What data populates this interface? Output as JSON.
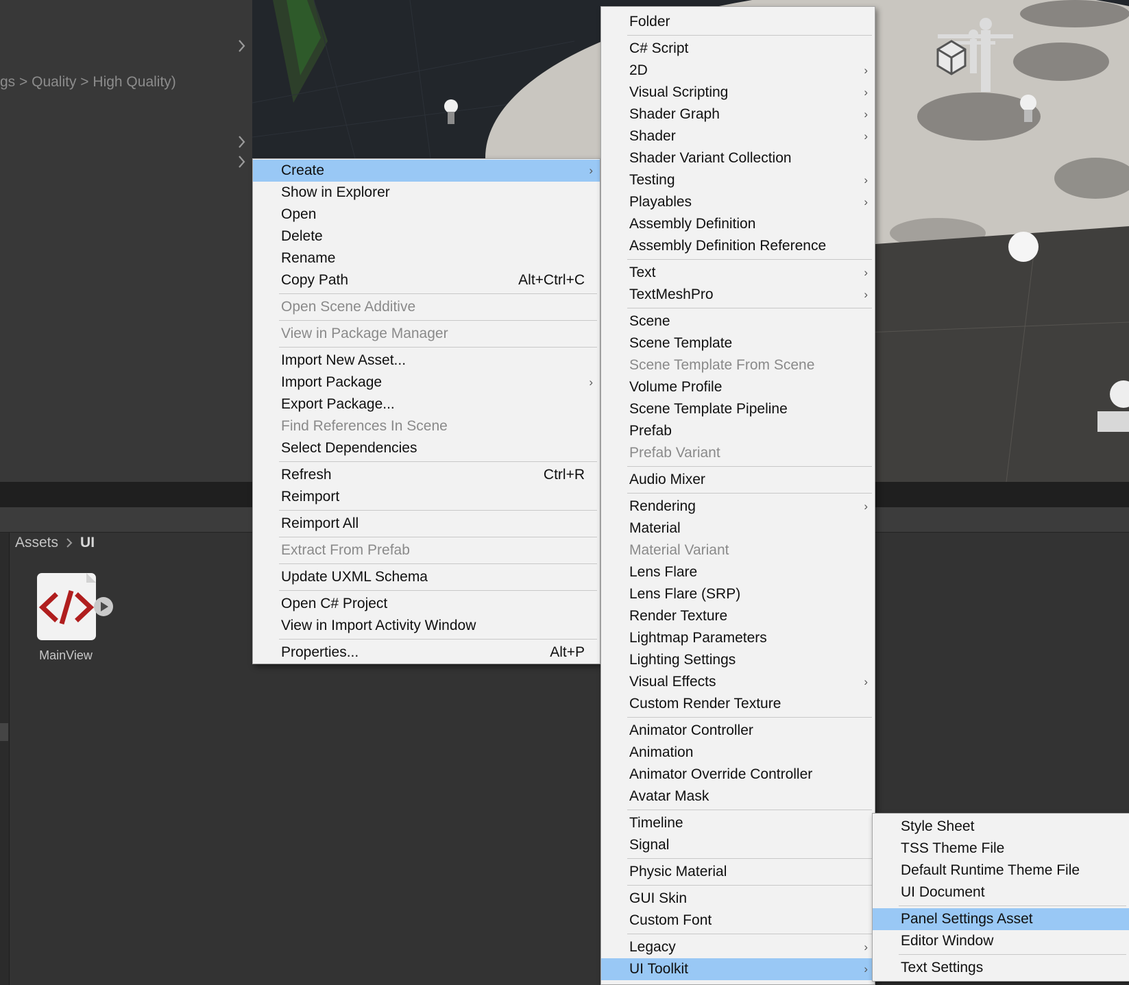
{
  "editor": {
    "breadcrumb_top": "gs > Quality > High Quality)",
    "project_breadcrumb": {
      "root": "Assets",
      "current": "UI"
    },
    "asset": {
      "name": "MainView",
      "icon": "uxml-document-icon"
    }
  },
  "menus": {
    "main": [
      {
        "label": "Create",
        "submenu": true,
        "selected": true
      },
      {
        "label": "Show in Explorer"
      },
      {
        "label": "Open"
      },
      {
        "label": "Delete"
      },
      {
        "label": "Rename"
      },
      {
        "label": "Copy Path",
        "shortcut": "Alt+Ctrl+C"
      },
      {
        "separator": true
      },
      {
        "label": "Open Scene Additive",
        "disabled": true
      },
      {
        "separator": true
      },
      {
        "label": "View in Package Manager",
        "disabled": true
      },
      {
        "separator": true
      },
      {
        "label": "Import New Asset..."
      },
      {
        "label": "Import Package",
        "submenu": true
      },
      {
        "label": "Export Package..."
      },
      {
        "label": "Find References In Scene",
        "disabled": true
      },
      {
        "label": "Select Dependencies"
      },
      {
        "separator": true
      },
      {
        "label": "Refresh",
        "shortcut": "Ctrl+R"
      },
      {
        "label": "Reimport"
      },
      {
        "separator": true
      },
      {
        "label": "Reimport All"
      },
      {
        "separator": true
      },
      {
        "label": "Extract From Prefab",
        "disabled": true
      },
      {
        "separator": true
      },
      {
        "label": "Update UXML Schema"
      },
      {
        "separator": true
      },
      {
        "label": "Open C# Project"
      },
      {
        "label": "View in Import Activity Window"
      },
      {
        "separator": true
      },
      {
        "label": "Properties...",
        "shortcut": "Alt+P"
      }
    ],
    "create": [
      {
        "label": "Folder"
      },
      {
        "separator": true
      },
      {
        "label": "C# Script"
      },
      {
        "label": "2D",
        "submenu": true
      },
      {
        "label": "Visual Scripting",
        "submenu": true
      },
      {
        "label": "Shader Graph",
        "submenu": true
      },
      {
        "label": "Shader",
        "submenu": true
      },
      {
        "label": "Shader Variant Collection"
      },
      {
        "label": "Testing",
        "submenu": true
      },
      {
        "label": "Playables",
        "submenu": true
      },
      {
        "label": "Assembly Definition"
      },
      {
        "label": "Assembly Definition Reference"
      },
      {
        "separator": true
      },
      {
        "label": "Text",
        "submenu": true
      },
      {
        "label": "TextMeshPro",
        "submenu": true
      },
      {
        "separator": true
      },
      {
        "label": "Scene"
      },
      {
        "label": "Scene Template"
      },
      {
        "label": "Scene Template From Scene",
        "disabled": true
      },
      {
        "label": "Volume Profile"
      },
      {
        "label": "Scene Template Pipeline"
      },
      {
        "label": "Prefab"
      },
      {
        "label": "Prefab Variant",
        "disabled": true
      },
      {
        "separator": true
      },
      {
        "label": "Audio Mixer"
      },
      {
        "separator": true
      },
      {
        "label": "Rendering",
        "submenu": true
      },
      {
        "label": "Material"
      },
      {
        "label": "Material Variant",
        "disabled": true
      },
      {
        "label": "Lens Flare"
      },
      {
        "label": "Lens Flare (SRP)"
      },
      {
        "label": "Render Texture"
      },
      {
        "label": "Lightmap Parameters"
      },
      {
        "label": "Lighting Settings"
      },
      {
        "label": "Visual Effects",
        "submenu": true
      },
      {
        "label": "Custom Render Texture"
      },
      {
        "separator": true
      },
      {
        "label": "Animator Controller"
      },
      {
        "label": "Animation"
      },
      {
        "label": "Animator Override Controller"
      },
      {
        "label": "Avatar Mask"
      },
      {
        "separator": true
      },
      {
        "label": "Timeline"
      },
      {
        "label": "Signal"
      },
      {
        "separator": true
      },
      {
        "label": "Physic Material"
      },
      {
        "separator": true
      },
      {
        "label": "GUI Skin"
      },
      {
        "label": "Custom Font"
      },
      {
        "separator": true
      },
      {
        "label": "Legacy",
        "submenu": true
      },
      {
        "label": "UI Toolkit",
        "submenu": true,
        "selected": true
      }
    ],
    "ui_toolkit": [
      {
        "label": "Style Sheet"
      },
      {
        "label": "TSS Theme File"
      },
      {
        "label": "Default Runtime Theme File"
      },
      {
        "label": "UI Document"
      },
      {
        "separator": true
      },
      {
        "label": "Panel Settings Asset",
        "selected": true
      },
      {
        "label": "Editor Window"
      },
      {
        "separator": true
      },
      {
        "label": "Text Settings"
      }
    ]
  },
  "colors": {
    "menu_bg": "#f2f2f2",
    "menu_highlight": "#99c8f5",
    "menu_disabled_text": "#8a8a8a",
    "editor_dark": "#282828",
    "uxml_icon_red": "#b01e1e"
  }
}
